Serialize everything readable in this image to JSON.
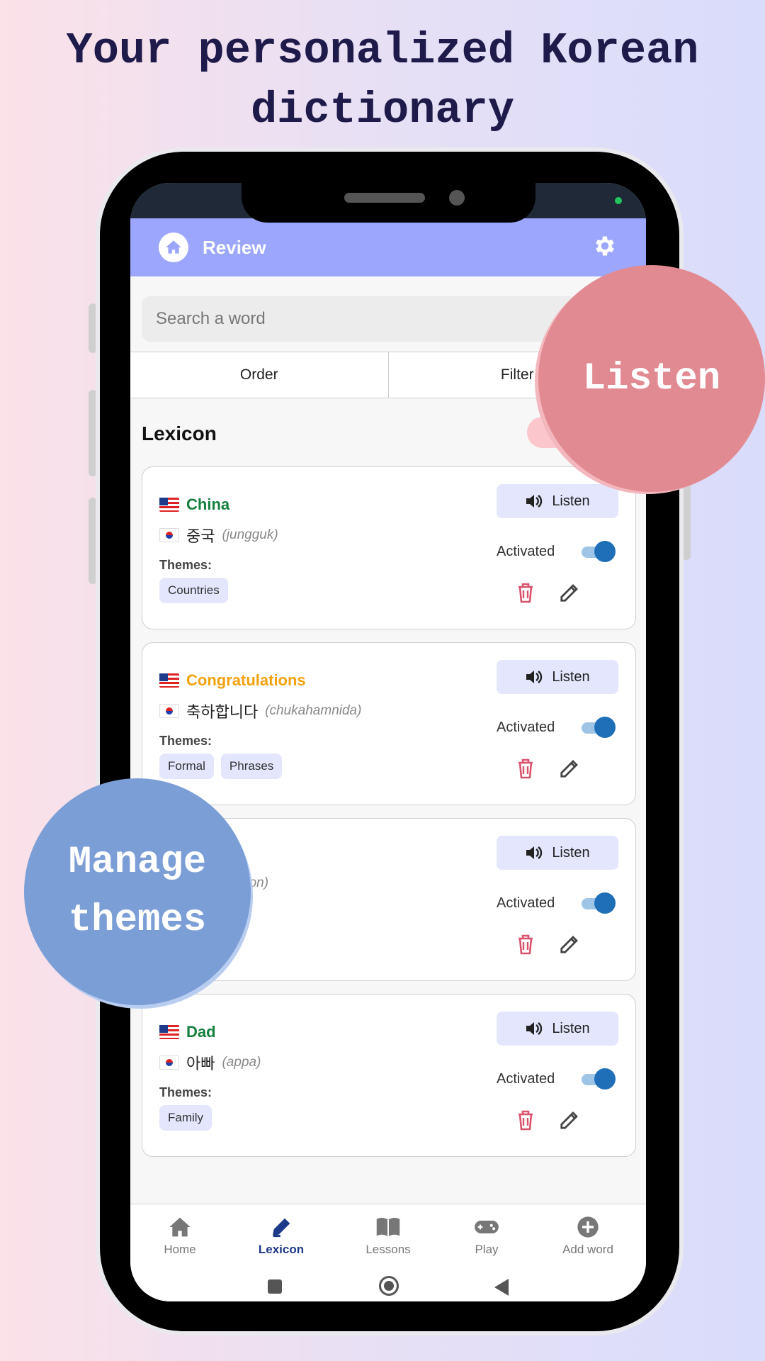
{
  "headline": [
    "Your personalized Korean",
    "dictionary"
  ],
  "appbar": {
    "title": "Review"
  },
  "search": {
    "placeholder": "Search a word"
  },
  "tabs": [
    {
      "label": "Order"
    },
    {
      "label": "Filter"
    }
  ],
  "section": {
    "title": "Lexicon"
  },
  "cards": [
    {
      "english": "China",
      "english_color": "#15803d",
      "korean": "중국",
      "romanization": "(jungguk)",
      "themes_label": "Themes:",
      "themes": [
        "Countries"
      ],
      "listen_label": "Listen",
      "activated_label": "Activated",
      "activated": true
    },
    {
      "english": "Congratulations",
      "english_color": "#f2a20f",
      "korean": "축하합니다",
      "romanization": "(chukahamnida)",
      "themes_label": "Themes:",
      "themes": [
        "Formal",
        "Phrases"
      ],
      "listen_label": "Listen",
      "activated_label": "Activated",
      "activated": true
    },
    {
      "romanization_partial": "non)",
      "listen_label": "Listen",
      "activated_label": "Activated",
      "activated": true
    },
    {
      "english": "Dad",
      "english_color": "#15803d",
      "korean": "아빠",
      "romanization": "(appa)",
      "themes_label": "Themes:",
      "themes": [
        "Family"
      ],
      "listen_label": "Listen",
      "activated_label": "Activated",
      "activated": true
    }
  ],
  "bottom_nav": [
    {
      "label": "Home",
      "icon": "home-icon",
      "active": false
    },
    {
      "label": "Lexicon",
      "icon": "pen-icon",
      "active": true
    },
    {
      "label": "Lessons",
      "icon": "book-icon",
      "active": false
    },
    {
      "label": "Play",
      "icon": "gamepad-icon",
      "active": false
    },
    {
      "label": "Add word",
      "icon": "plus-circle-icon",
      "active": false
    }
  ],
  "callouts": {
    "listen": "Listen",
    "manage_themes": [
      "Manage",
      "themes"
    ]
  },
  "colors": {
    "appbar": "#9ba6fc",
    "accent_active": "#1d3a8a",
    "toggle": "#1f6fb8",
    "delete": "#d9536b"
  }
}
